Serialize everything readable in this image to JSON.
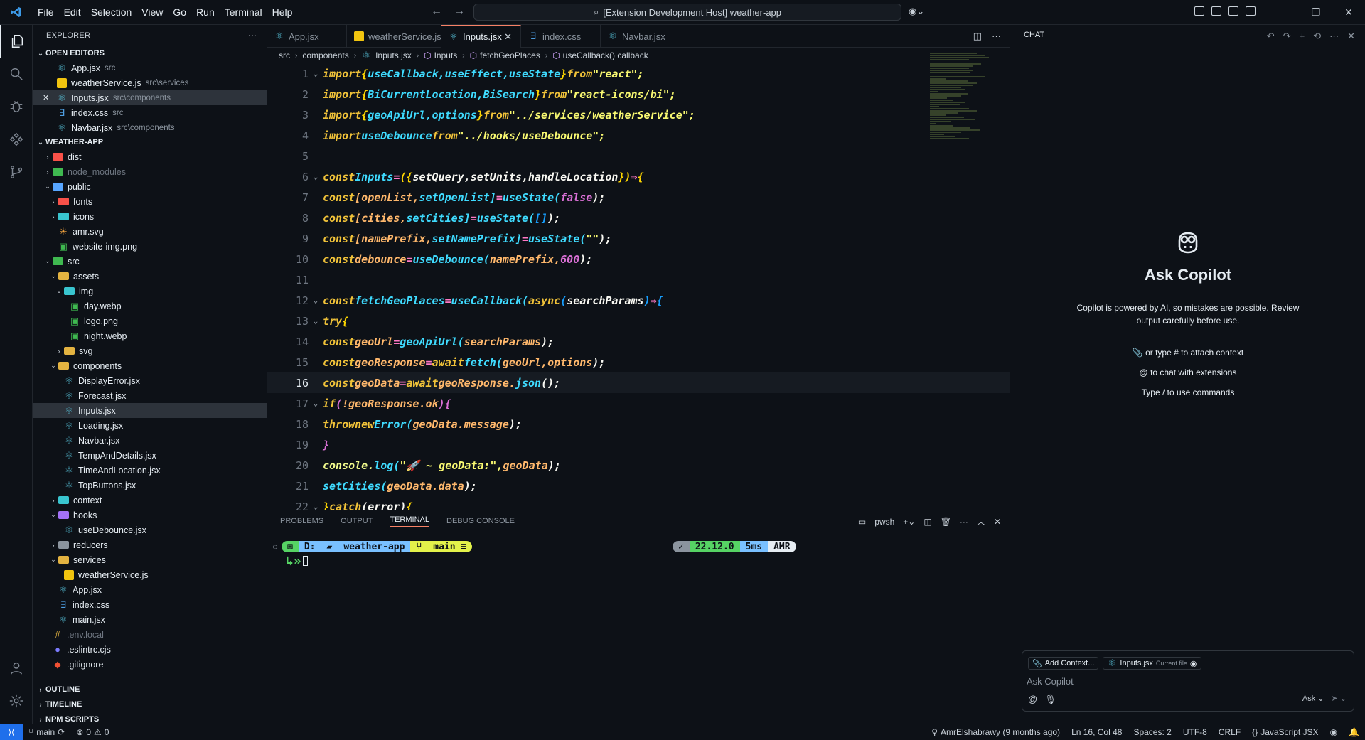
{
  "menu": [
    "File",
    "Edit",
    "Selection",
    "View",
    "Go",
    "Run",
    "Terminal",
    "Help"
  ],
  "search": {
    "text": "[Extension Development Host] weather-app"
  },
  "explorer": {
    "title": "EXPLORER",
    "open_editors_label": "OPEN EDITORS",
    "open_editors": [
      {
        "name": "App.jsx",
        "desc": "src",
        "icon": "react"
      },
      {
        "name": "weatherService.js",
        "desc": "src\\services",
        "icon": "js"
      },
      {
        "name": "Inputs.jsx",
        "desc": "src\\components",
        "icon": "react"
      },
      {
        "name": "index.css",
        "desc": "src",
        "icon": "css"
      },
      {
        "name": "Navbar.jsx",
        "desc": "src\\components",
        "icon": "react"
      }
    ],
    "project_label": "WEATHER-APP",
    "tree": [
      {
        "name": "dist"
      },
      {
        "name": "node_modules"
      },
      {
        "name": "public"
      },
      {
        "name": "fonts"
      },
      {
        "name": "icons"
      },
      {
        "name": "amr.svg"
      },
      {
        "name": "website-img.png"
      },
      {
        "name": "src"
      },
      {
        "name": "assets"
      },
      {
        "name": "img"
      },
      {
        "name": "day.webp"
      },
      {
        "name": "logo.png"
      },
      {
        "name": "night.webp"
      },
      {
        "name": "svg"
      },
      {
        "name": "components"
      },
      {
        "name": "DisplayError.jsx"
      },
      {
        "name": "Forecast.jsx"
      },
      {
        "name": "Inputs.jsx"
      },
      {
        "name": "Loading.jsx"
      },
      {
        "name": "Navbar.jsx"
      },
      {
        "name": "TempAndDetails.jsx"
      },
      {
        "name": "TimeAndLocation.jsx"
      },
      {
        "name": "TopButtons.jsx"
      },
      {
        "name": "context"
      },
      {
        "name": "hooks"
      },
      {
        "name": "useDebounce.jsx"
      },
      {
        "name": "reducers"
      },
      {
        "name": "services"
      },
      {
        "name": "weatherService.js"
      },
      {
        "name": "App.jsx"
      },
      {
        "name": "index.css"
      },
      {
        "name": "main.jsx"
      },
      {
        "name": ".env.local"
      },
      {
        "name": ".eslintrc.cjs"
      },
      {
        "name": ".gitignore"
      }
    ],
    "outline": "OUTLINE",
    "timeline": "TIMELINE",
    "npm": "NPM SCRIPTS"
  },
  "tabs": [
    "App.jsx",
    "weatherService.js",
    "Inputs.jsx",
    "index.css",
    "Navbar.jsx"
  ],
  "breadcrumb": [
    "src",
    "components",
    "Inputs.jsx",
    "Inputs",
    "fetchGeoPlaces",
    "useCallback() callback"
  ],
  "code_lines": [
    "1",
    "2",
    "3",
    "4",
    "5",
    "6",
    "7",
    "8",
    "9",
    "10",
    "11",
    "12",
    "13",
    "14",
    "15",
    "16",
    "17",
    "18",
    "19",
    "20",
    "21",
    "22"
  ],
  "code": {
    "l1": [
      "import",
      "{",
      "useCallback,",
      "useEffect,",
      "useState",
      "}",
      "from",
      "\"react\";"
    ],
    "l2": [
      "import",
      "{",
      "BiCurrentLocation,",
      "BiSearch",
      "}",
      "from",
      "\"react-icons/bi\";"
    ],
    "l3": [
      "import",
      "{",
      "geoApiUrl,",
      "options",
      "}",
      "from",
      "\"../services/weatherService\";"
    ],
    "l4": [
      "import",
      "useDebounce",
      "from",
      "\"../hooks/useDebounce\";"
    ],
    "l6": [
      "const",
      "Inputs",
      "=",
      "({",
      "setQuery,",
      "setUnits,",
      "handleLocation",
      "})",
      "⇒",
      "{"
    ],
    "l7": [
      "const",
      "[openList,",
      "setOpenList]",
      "=",
      "useState(",
      "false",
      ");"
    ],
    "l8": [
      "const",
      "[cities,",
      "setCities]",
      "=",
      "useState(",
      "[]",
      ");"
    ],
    "l9": [
      "const",
      "[namePrefix,",
      "setNamePrefix]",
      "=",
      "useState(",
      "\"\"",
      ");"
    ],
    "l10": [
      "const",
      "debounce",
      "=",
      "useDebounce(",
      "namePrefix,",
      "600",
      ");"
    ],
    "l12": [
      "const",
      "fetchGeoPlaces",
      "=",
      "useCallback(",
      "async",
      "(",
      "searchParams",
      ")",
      "⇒",
      "{"
    ],
    "l13": [
      "try",
      "{"
    ],
    "l14": [
      "const",
      "geoUrl",
      "=",
      "geoApiUrl(",
      "searchParams",
      ");"
    ],
    "l15": [
      "const",
      "geoResponse",
      "=",
      "await",
      "fetch(",
      "geoUrl,",
      "options",
      ");"
    ],
    "l16": [
      "const",
      "geoData",
      "=",
      "await",
      "geoResponse.",
      "json",
      "();"
    ],
    "l17": [
      "if",
      "(",
      "!geoResponse.",
      "ok",
      ")",
      "{"
    ],
    "l18": [
      "throw",
      "new",
      "Error(",
      "geoData.",
      "message",
      ");"
    ],
    "l19": [
      "}"
    ],
    "l20": [
      "console.",
      "log(",
      "\"🚀 ~ geoData:\",",
      "geoData",
      ");"
    ],
    "l21": [
      "setCities(",
      "geoData.",
      "data",
      ");"
    ],
    "l22": [
      "}",
      "catch",
      "(error)",
      "{"
    ]
  },
  "panel": {
    "tabs": [
      "PROBLEMS",
      "OUTPUT",
      "TERMINAL",
      "DEBUG CONSOLE"
    ],
    "shell": "pwsh",
    "prompt_left": [
      "D:",
      "weather-app",
      "main ≡"
    ],
    "prompt_right": [
      "22.12.0",
      "5ms",
      "AMR"
    ]
  },
  "chat": {
    "tab": "CHAT",
    "title": "Ask Copilot",
    "subtitle": "Copilot is powered by AI, so mistakes are possible. Review output carefully before use.",
    "hint1": "or type # to attach context",
    "hint2": "to chat with extensions",
    "hint3": "Type / to use commands",
    "add_context": "Add Context...",
    "current_file": "Inputs.jsx",
    "current_file_tag": "Current file",
    "placeholder": "Ask Copilot",
    "mode": "Ask"
  },
  "status": {
    "branch": "main",
    "errors": "0",
    "warnings": "0",
    "blame": "AmrElshabrawy (9 months ago)",
    "position": "Ln 16, Col 48",
    "spaces": "Spaces: 2",
    "encoding": "UTF-8",
    "eol": "CRLF",
    "language": "JavaScript JSX"
  },
  "colors": {
    "accent": "#f78166",
    "remote": "#1f6feb",
    "keyword": "#f0c239",
    "func": "#3fdbff",
    "string": "#f8f871"
  }
}
